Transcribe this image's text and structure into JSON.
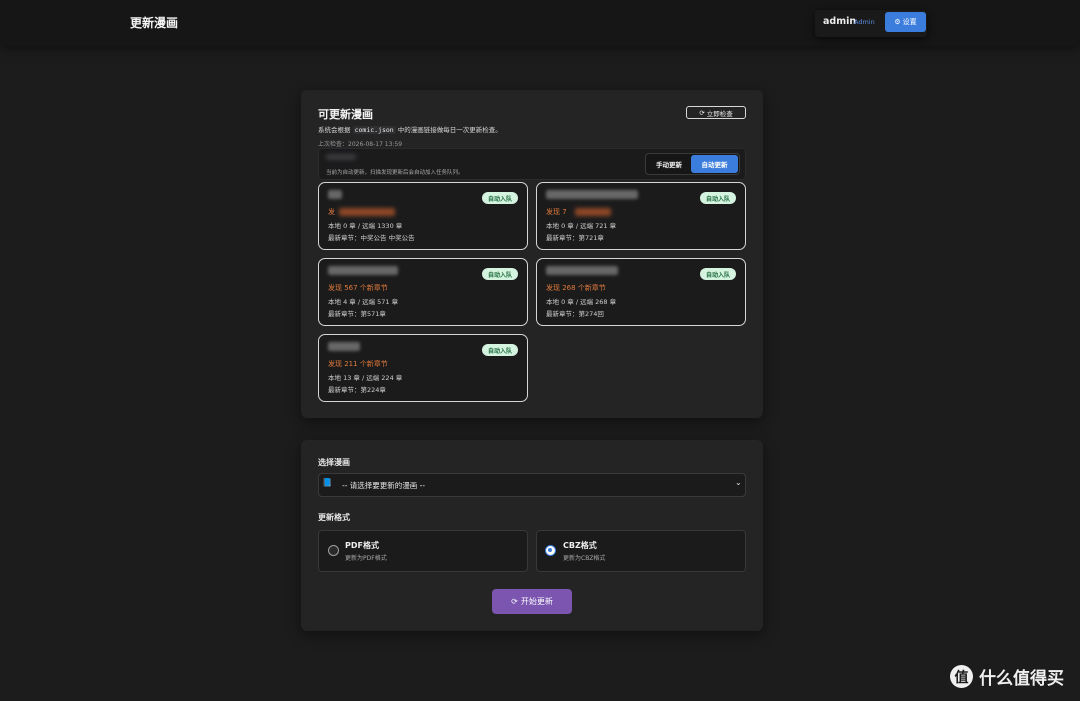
{
  "header": {
    "title": "更新漫画",
    "user": "admin",
    "role": "Admin",
    "settings_label": "设置"
  },
  "updatable": {
    "title": "可更新漫画",
    "desc_prefix": "系统会根据",
    "desc_code": "comic.json",
    "desc_suffix": "中的漫画链接做每日一次更新检查。",
    "last_check_label": "上次检查：",
    "last_check_time": "2026-08-17 13:59",
    "check_now_label": "立即检查",
    "mode_hint": "当前为自动更新，扫描发现更新后会自动加入任务队列。",
    "manual_label": "手动更新",
    "auto_label": "自动更新",
    "cards": [
      {
        "badge": "自动入队",
        "found": "发",
        "count": "本地 0 章 / 远端 1330 章",
        "latest": "最新章节：中奖公告 中奖公告"
      },
      {
        "badge": "自动入队",
        "found": "发现 7",
        "count": "本地 0 章 / 远端 721 章",
        "latest": "最新章节：第721章"
      },
      {
        "badge": "自动入队",
        "found": "发现 567 个新章节",
        "count": "本地 4 章 / 远端 571 章",
        "latest": "最新章节：第571章"
      },
      {
        "badge": "自动入队",
        "found": "发现 268 个新章节",
        "count": "本地 0 章 / 远端 268 章",
        "latest": "最新章节：第274回"
      },
      {
        "badge": "自动入队",
        "found": "发现 211 个新章节",
        "count": "本地 13 章 / 远端 224 章",
        "latest": "最新章节：第224章"
      }
    ]
  },
  "form": {
    "select_label": "选择漫画",
    "select_placeholder": "-- 请选择要更新的漫画 --",
    "format_label": "更新格式",
    "formats": [
      {
        "title": "PDF格式",
        "sub": "更新为PDF格式",
        "selected": false
      },
      {
        "title": "CBZ格式",
        "sub": "更新为CBZ格式",
        "selected": true
      }
    ],
    "start_label": "开始更新"
  },
  "watermark": {
    "logo": "值",
    "text": "什么值得买"
  },
  "colors": {
    "accent": "#3b7ddd",
    "start_button": "#7b55b0",
    "found_text": "#e07a3a",
    "badge_bg": "#d4f4e0"
  }
}
